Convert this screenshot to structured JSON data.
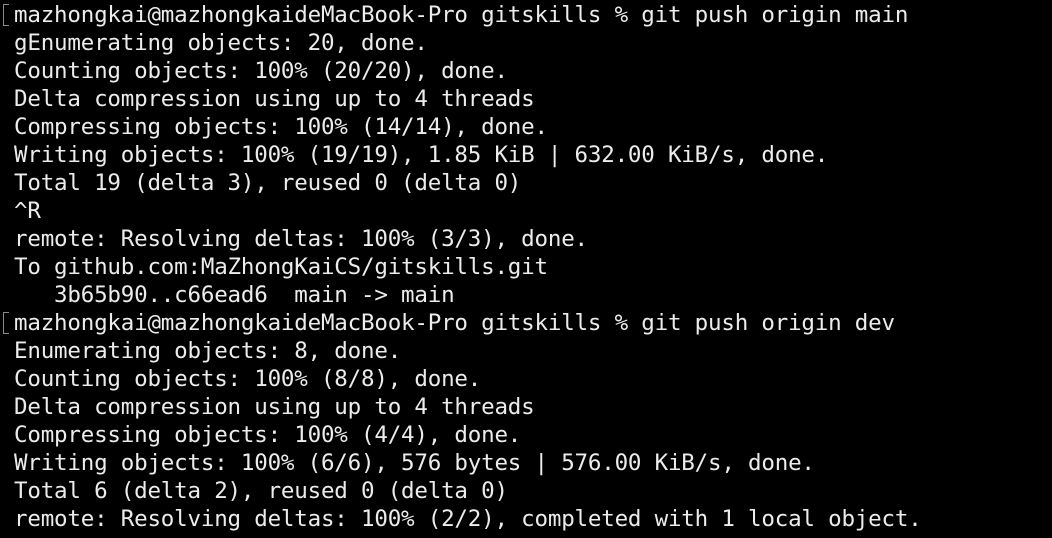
{
  "terminal": {
    "lines": [
      "mazhongkai@mazhongkaideMacBook-Pro gitskills % git push origin main",
      "gEnumerating objects: 20, done.",
      "Counting objects: 100% (20/20), done.",
      "Delta compression using up to 4 threads",
      "Compressing objects: 100% (14/14), done.",
      "Writing objects: 100% (19/19), 1.85 KiB | 632.00 KiB/s, done.",
      "Total 19 (delta 3), reused 0 (delta 0)",
      "^R",
      "remote: Resolving deltas: 100% (3/3), done.",
      "To github.com:MaZhongKaiCS/gitskills.git",
      "   3b65b90..c66ead6  main -> main",
      "mazhongkai@mazhongkaideMacBook-Pro gitskills % git push origin dev",
      "Enumerating objects: 8, done.",
      "Counting objects: 100% (8/8), done.",
      "Delta compression using up to 4 threads",
      "Compressing objects: 100% (4/4), done.",
      "Writing objects: 100% (6/6), 576 bytes | 576.00 KiB/s, done.",
      "Total 6 (delta 2), reused 0 (delta 0)",
      "remote: Resolving deltas: 100% (2/2), completed with 1 local object."
    ]
  },
  "colors": {
    "background": "#000000",
    "text": "#ececec",
    "prompt_marker": "#8a8a8a"
  }
}
